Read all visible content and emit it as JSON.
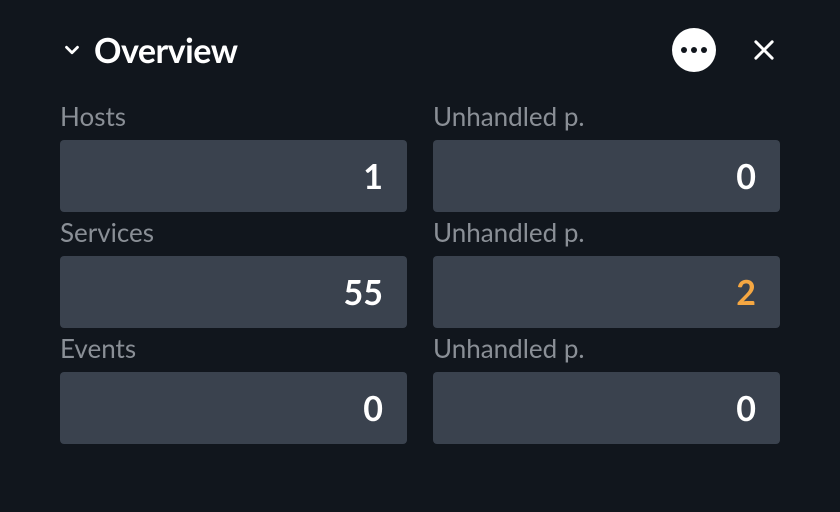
{
  "header": {
    "title": "Overview"
  },
  "metrics": {
    "hosts": {
      "label": "Hosts",
      "value": "1"
    },
    "hostsUnhandled": {
      "label": "Unhandled p.",
      "value": "0"
    },
    "services": {
      "label": "Services",
      "value": "55"
    },
    "servicesUnhandled": {
      "label": "Unhandled p.",
      "value": "2"
    },
    "events": {
      "label": "Events",
      "value": "0"
    },
    "eventsUnhandled": {
      "label": "Unhandled p.",
      "value": "0"
    }
  }
}
